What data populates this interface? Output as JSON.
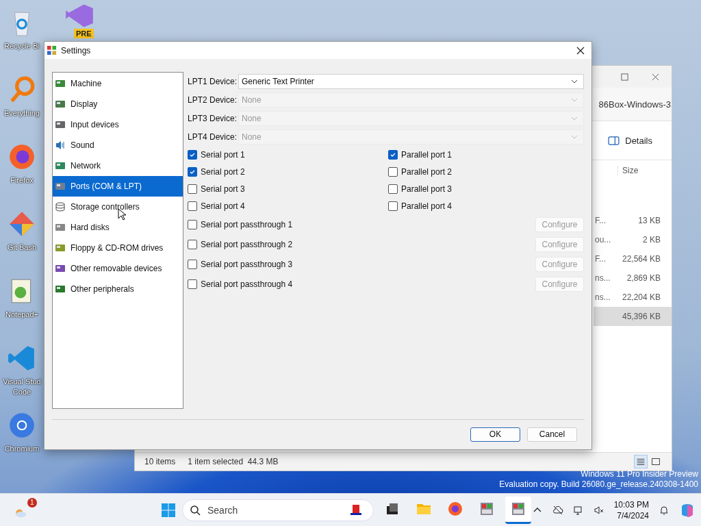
{
  "desktop": {
    "icons": [
      {
        "kind": "recycle",
        "label": "Recycle Bi"
      },
      {
        "kind": "search-ring",
        "label": "Everything"
      },
      {
        "kind": "fox",
        "label": "Firefox"
      },
      {
        "kind": "diamond",
        "label": "Git Bash"
      },
      {
        "kind": "notepad",
        "label": "Notepad+"
      },
      {
        "kind": "vscode",
        "label": "Visual Stud Code"
      },
      {
        "kind": "chromium",
        "label": "Chromium"
      }
    ],
    "preview_icon": {
      "badge": "PRE"
    },
    "watermark": [
      "Windows 11 Pro Insider Preview",
      "Evaluation copy. Build 26080.ge_release.240308-1400"
    ]
  },
  "explorer": {
    "title": "86Box-Windows-3",
    "toolbar": {
      "details": "Details"
    },
    "columns": [
      "Size"
    ],
    "rows": [
      {
        "name": "F...",
        "size": "13 KB",
        "selected": false
      },
      {
        "name": "ou...",
        "size": "2 KB",
        "selected": false
      },
      {
        "name": "F...",
        "size": "22,564 KB",
        "selected": false
      },
      {
        "name": "ns...",
        "size": "2,869 KB",
        "selected": false
      },
      {
        "name": "ns...",
        "size": "22,204 KB",
        "selected": false
      },
      {
        "name": "",
        "size": "45,396 KB",
        "selected": true
      }
    ],
    "status_bar": {
      "count": "10 items",
      "selection": "1 item selected  44.3 MB"
    }
  },
  "settings": {
    "title": "Settings",
    "sidebar": {
      "items": [
        {
          "kind": "machine",
          "label": "Machine",
          "selected": false
        },
        {
          "kind": "display",
          "label": "Display",
          "selected": false
        },
        {
          "kind": "input",
          "label": "Input devices",
          "selected": false
        },
        {
          "kind": "sound",
          "label": "Sound",
          "selected": false
        },
        {
          "kind": "network",
          "label": "Network",
          "selected": false
        },
        {
          "kind": "ports",
          "label": "Ports (COM & LPT)",
          "selected": true
        },
        {
          "kind": "storage",
          "label": "Storage controllers",
          "selected": false
        },
        {
          "kind": "disk",
          "label": "Hard disks",
          "selected": false
        },
        {
          "kind": "floppy",
          "label": "Floppy & CD-ROM drives",
          "selected": false
        },
        {
          "kind": "removable",
          "label": "Other removable devices",
          "selected": false
        },
        {
          "kind": "peripheral",
          "label": "Other peripherals",
          "selected": false
        }
      ]
    },
    "lpt_devices": [
      {
        "label": "LPT1 Device:",
        "value": "Generic Text Printer",
        "disabled": false
      },
      {
        "label": "LPT2 Device:",
        "value": "None",
        "disabled": true
      },
      {
        "label": "LPT3 Device:",
        "value": "None",
        "disabled": true
      },
      {
        "label": "LPT4 Device:",
        "value": "None",
        "disabled": true
      }
    ],
    "serial_ports": [
      {
        "label": "Serial port 1",
        "checked": true
      },
      {
        "label": "Serial port 2",
        "checked": true
      },
      {
        "label": "Serial port 3",
        "checked": false
      },
      {
        "label": "Serial port 4",
        "checked": false
      }
    ],
    "parallel_ports": [
      {
        "label": "Parallel port 1",
        "checked": true
      },
      {
        "label": "Parallel port 2",
        "checked": false
      },
      {
        "label": "Parallel port 3",
        "checked": false
      },
      {
        "label": "Parallel port 4",
        "checked": false
      }
    ],
    "passthrough": [
      {
        "label": "Serial port passthrough 1",
        "checked": false,
        "button": "Configure",
        "disabled": true
      },
      {
        "label": "Serial port passthrough 2",
        "checked": false,
        "button": "Configure",
        "disabled": true
      },
      {
        "label": "Serial port passthrough 3",
        "checked": false,
        "button": "Configure",
        "disabled": true
      },
      {
        "label": "Serial port passthrough 4",
        "checked": false,
        "button": "Configure",
        "disabled": true
      }
    ],
    "buttons": [
      {
        "kind": "primary",
        "label": "OK"
      },
      {
        "kind": "normal",
        "label": "Cancel"
      }
    ]
  },
  "taskbar": {
    "weather_badge": "1",
    "search": {
      "placeholder": "Search"
    },
    "apps": [
      {
        "kind": "taskview",
        "active": false
      },
      {
        "kind": "folder",
        "active": false
      },
      {
        "kind": "fox",
        "active": false
      },
      {
        "kind": "box",
        "active": false
      },
      {
        "kind": "box",
        "active": true
      }
    ],
    "time": "10:03 PM",
    "date": "7/4/2024"
  }
}
